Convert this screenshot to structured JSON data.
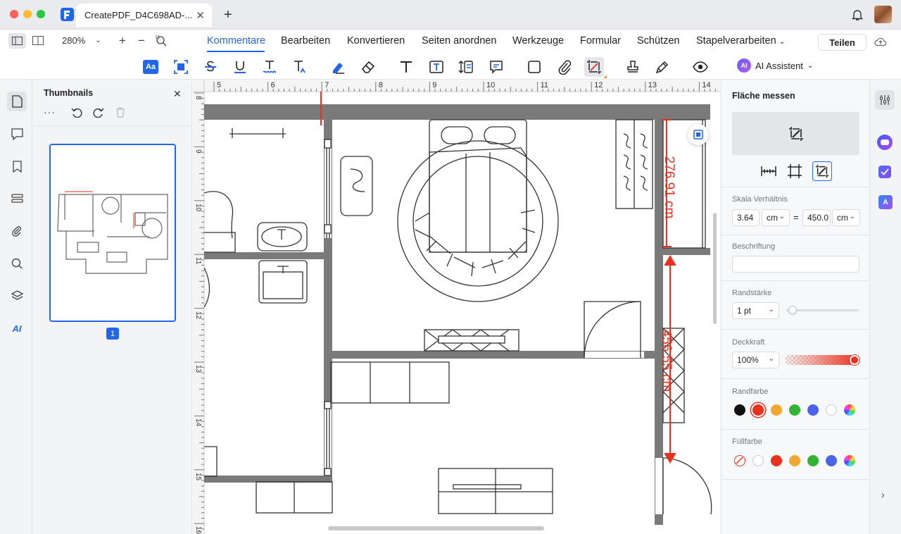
{
  "window": {
    "tab_title": "CreatePDF_D4C698AD-...",
    "new_tab": "+",
    "close": "✕"
  },
  "toolbar": {
    "zoom": "280%",
    "zoom_in": "+",
    "zoom_out": "−",
    "share": "Teilen"
  },
  "menu": [
    {
      "label": "Kommentare",
      "active": true
    },
    {
      "label": "Bearbeiten"
    },
    {
      "label": "Konvertieren"
    },
    {
      "label": "Seiten anordnen"
    },
    {
      "label": "Werkzeuge"
    },
    {
      "label": "Formular"
    },
    {
      "label": "Schützen"
    },
    {
      "label": "Stapelverarbeiten"
    }
  ],
  "ai": {
    "badge": "AI",
    "label": "AI Assistent"
  },
  "tools": {
    "text_box": "Aa"
  },
  "thumbnails": {
    "title": "Thumbnails",
    "more": "···",
    "page_label": "1"
  },
  "rail": {
    "ai_label": "AI"
  },
  "ruler": {
    "h_ticks": [
      "5",
      "6",
      "7",
      "8",
      "9",
      "10",
      "11",
      "12",
      "13",
      "14"
    ],
    "v_ticks": [
      "8",
      "9",
      "10",
      "11",
      "12",
      "13",
      "14",
      "15",
      "16"
    ]
  },
  "measure": {
    "vertical_1": "276.91 cm",
    "vertical_2": "456.55 cm"
  },
  "panel": {
    "title": "Fläche messen",
    "scale_label": "Skala Verhältnis",
    "scale_left": "3.64",
    "unit_left": "cm",
    "equals": "=",
    "scale_right": "450.0",
    "unit_right": "cm",
    "caption_label": "Beschriftung",
    "caption_value": "",
    "border_width_label": "Randstärke",
    "border_width": "1 pt",
    "border_width_value": 0.03,
    "opacity_label": "Deckkraft",
    "opacity": "100%",
    "opacity_value": 1.0,
    "border_color_label": "Randfarbe",
    "fill_color_label": "Füllfarbe",
    "border_colors": [
      "#111111",
      "#e8321f",
      "#f0a830",
      "#32b432",
      "#4a63e8",
      "#ffffff",
      "rainbow"
    ],
    "fill_colors": [
      "none",
      "#ffffff",
      "#e8321f",
      "#f0a830",
      "#32b432",
      "#4a63e8",
      "rainbow"
    ],
    "selected_border_color": "#e8321f"
  },
  "colors": {
    "accent": "#2466e8",
    "measure": "#e8321f",
    "wall": "#7a7a7a"
  }
}
